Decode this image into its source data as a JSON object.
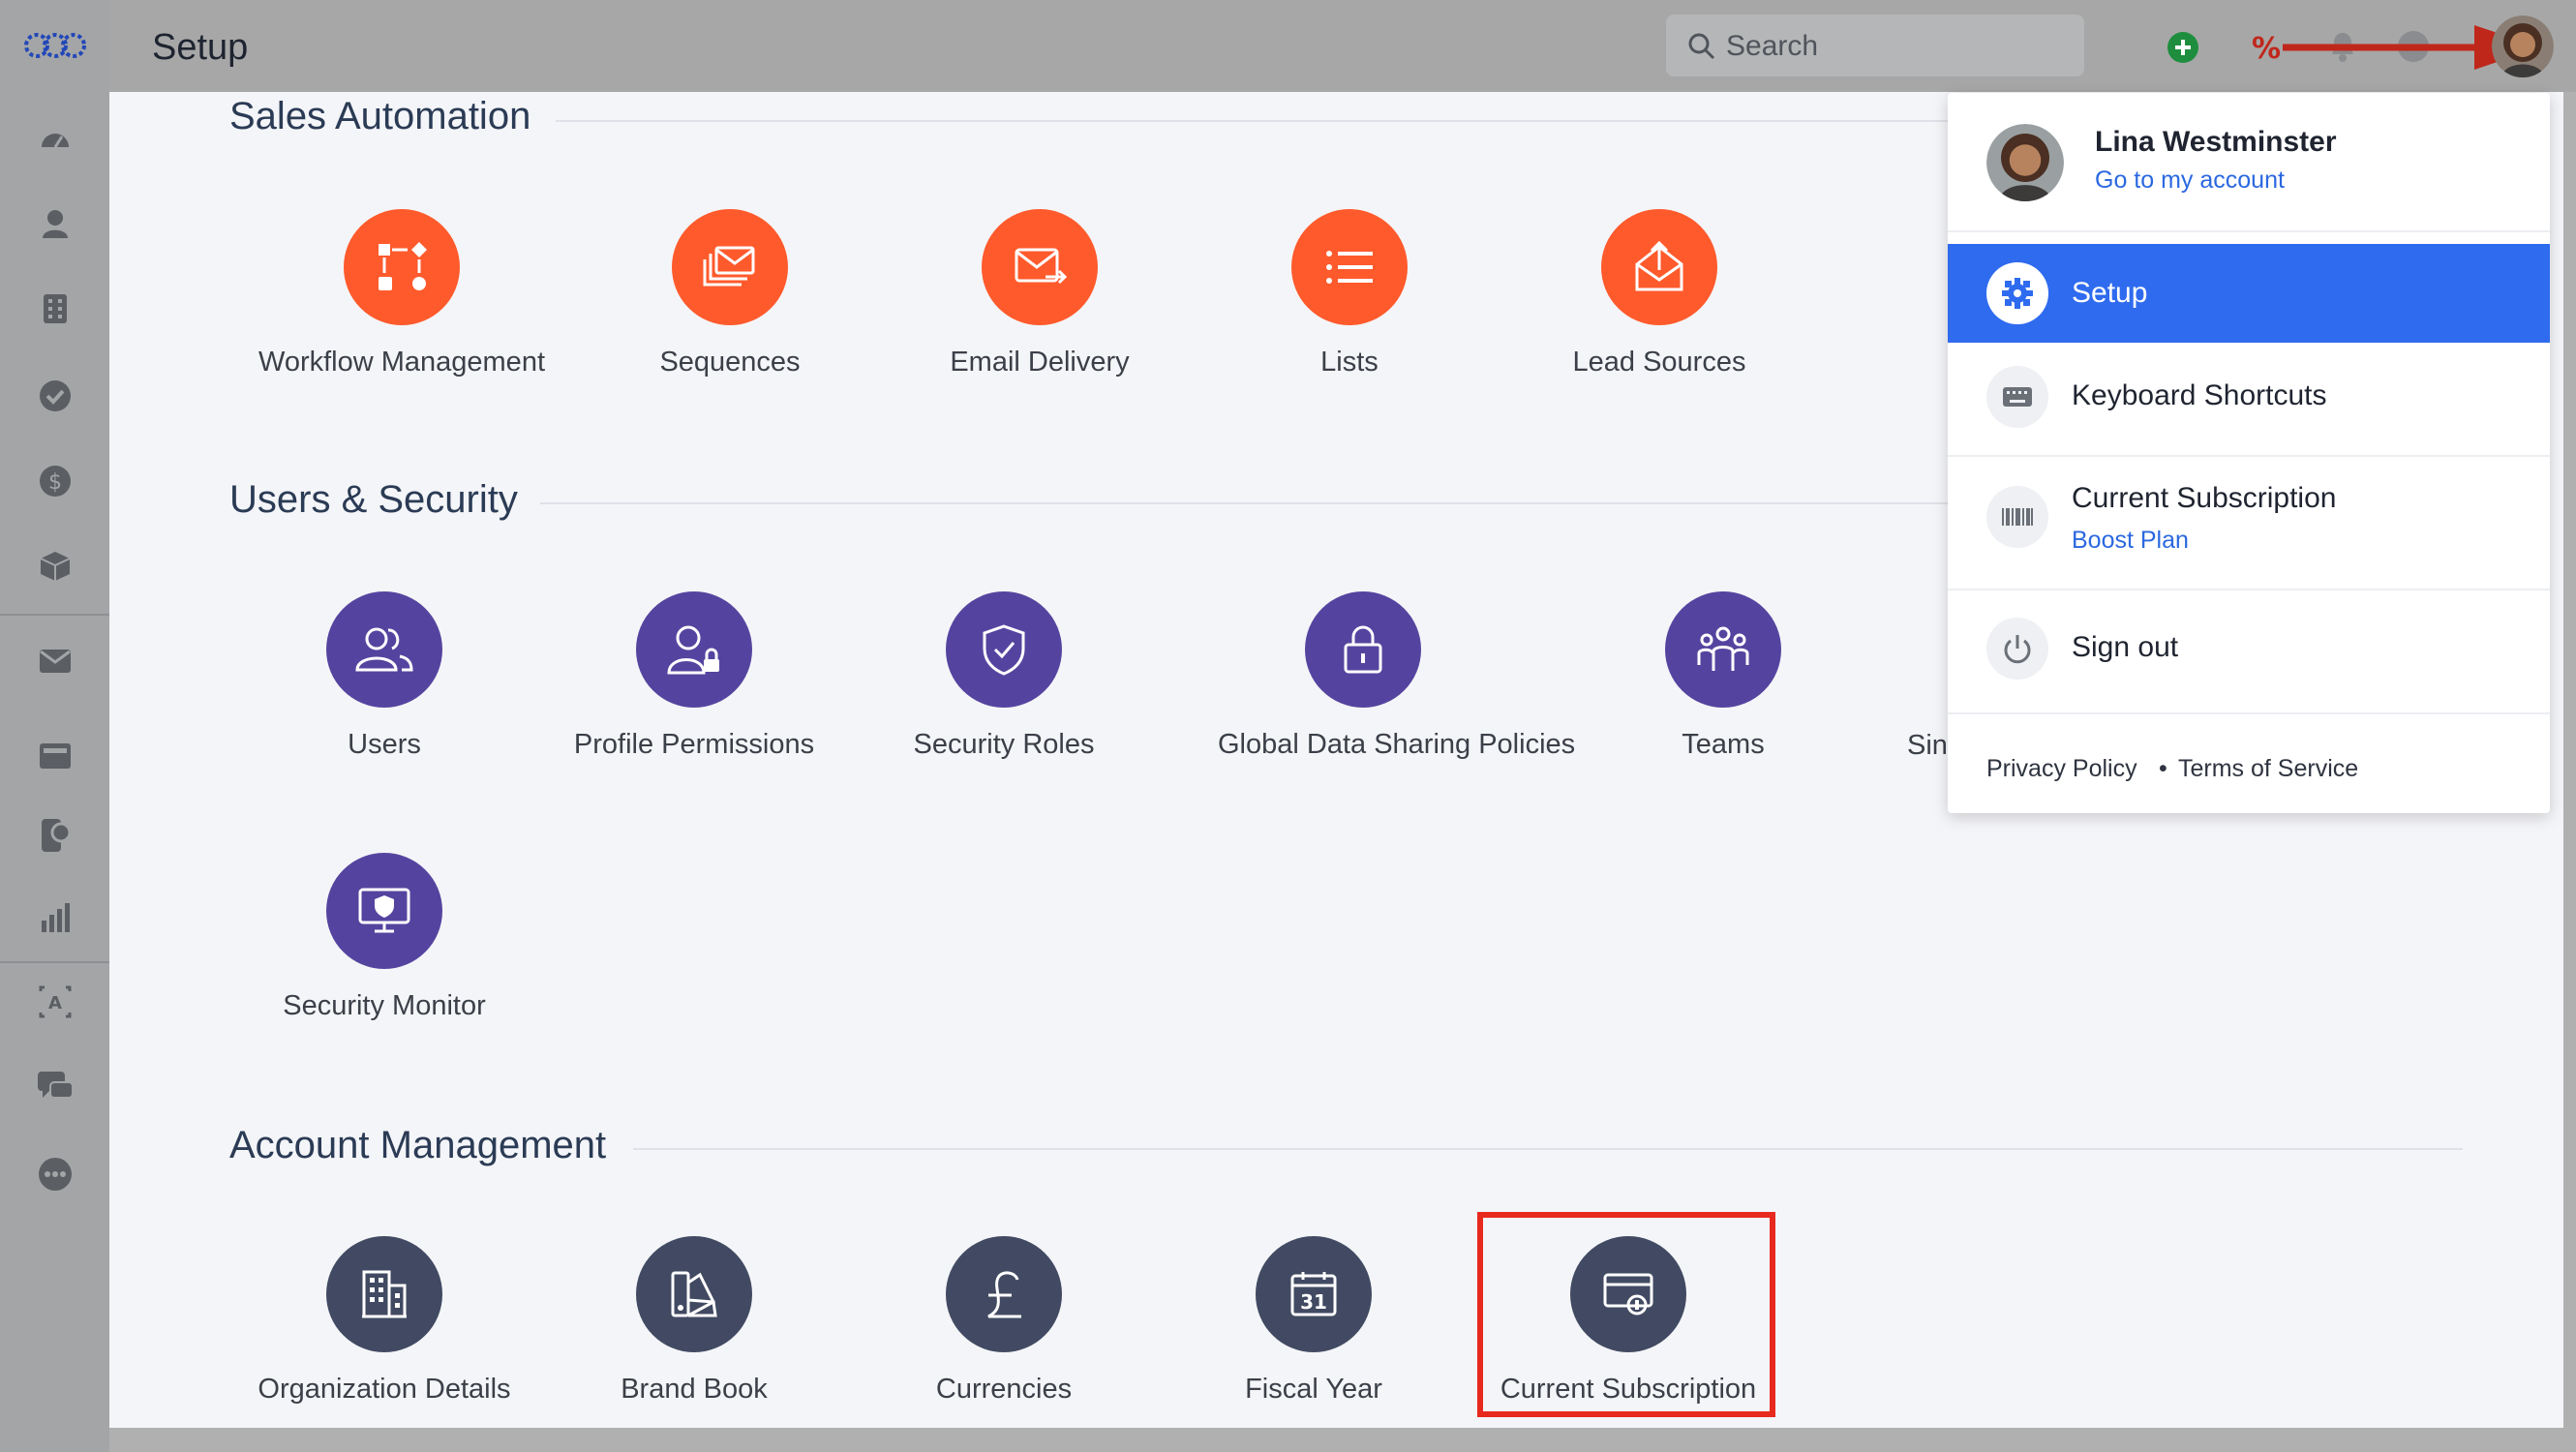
{
  "header": {
    "title": "Setup",
    "search_placeholder": "Search"
  },
  "sidebar": {
    "icons": [
      "gauge-icon",
      "contact-icon",
      "building-icon",
      "check-circle-icon",
      "dollar-icon",
      "product-box-icon",
      "mail-icon",
      "inbox-icon",
      "phone-chat-icon",
      "bar-chart-icon",
      "ai-assistant-icon",
      "chat-icon",
      "more-icon"
    ]
  },
  "sections": {
    "sales": {
      "title": "Sales Automation",
      "items": [
        {
          "label": "Workflow Management",
          "icon": "workflow-icon"
        },
        {
          "label": "Sequences",
          "icon": "sequences-icon"
        },
        {
          "label": "Email Delivery",
          "icon": "email-delivery-icon"
        },
        {
          "label": "Lists",
          "icon": "list-icon"
        },
        {
          "label": "Lead Sources",
          "icon": "lead-sources-icon"
        }
      ]
    },
    "users": {
      "title": "Users & Security",
      "items": [
        {
          "label": "Users",
          "icon": "users-icon"
        },
        {
          "label": "Profile Permissions",
          "icon": "profile-permissions-icon"
        },
        {
          "label": "Security Roles",
          "icon": "shield-icon"
        },
        {
          "label": "Global Data Sharing Policies",
          "icon": "lock-icon"
        },
        {
          "label": "Teams",
          "icon": "teams-icon"
        },
        {
          "label": "Sin",
          "icon": ""
        },
        {
          "label": "Security Monitor",
          "icon": "monitor-icon"
        }
      ]
    },
    "account": {
      "title": "Account Management",
      "items": [
        {
          "label": "Organization Details",
          "icon": "building-icon"
        },
        {
          "label": "Brand Book",
          "icon": "brand-book-icon"
        },
        {
          "label": "Currencies",
          "icon": "pound-icon"
        },
        {
          "label": "Fiscal Year",
          "icon": "calendar-icon",
          "day": "31"
        },
        {
          "label": "Current Subscription",
          "icon": "subscription-icon"
        }
      ]
    }
  },
  "dropdown": {
    "user_name": "Lina Westminster",
    "account_link": "Go to my account",
    "items": [
      {
        "label": "Setup",
        "icon": "gear-icon",
        "active": true
      },
      {
        "label": "Keyboard Shortcuts",
        "icon": "keyboard-icon"
      },
      {
        "label": "Current Subscription",
        "icon": "barcode-icon",
        "sub": "Boost Plan"
      },
      {
        "label": "Sign out",
        "icon": "power-icon"
      }
    ],
    "footer": {
      "privacy": "Privacy Policy",
      "separator": "•",
      "terms": "Terms of Service"
    }
  },
  "colors": {
    "sales_accent": "#ff5a2c",
    "users_accent": "#55449f",
    "account_accent": "#414a62",
    "active_blue": "#2f6bef",
    "highlight_red": "#e8291e"
  }
}
